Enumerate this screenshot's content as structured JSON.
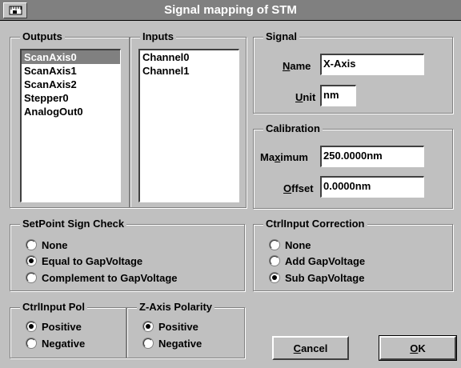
{
  "window": {
    "title": "Signal mapping of STM",
    "system_menu_icon": "ruler-icon"
  },
  "outputs": {
    "legend": "Outputs",
    "items": [
      "ScanAxis0",
      "ScanAxis1",
      "ScanAxis2",
      "Stepper0",
      "AnalogOut0"
    ],
    "selected": "ScanAxis0"
  },
  "inputs": {
    "legend": "Inputs",
    "items": [
      "Channel0",
      "Channel1"
    ]
  },
  "signal": {
    "legend": "Signal",
    "name_label_u": "N",
    "name_label_rest": "ame",
    "name_value": "X-Axis",
    "unit_label_u": "U",
    "unit_label_rest": "nit",
    "unit_value": "nm"
  },
  "calibration": {
    "legend": "Calibration",
    "max_label_pre": "Ma",
    "max_label_u": "x",
    "max_label_rest": "imum",
    "max_value": "250.0000nm",
    "offset_label_u": "O",
    "offset_label_rest": "ffset",
    "offset_value": "0.0000nm"
  },
  "setpoint": {
    "legend": "SetPoint Sign Check",
    "options": [
      "None",
      "Equal to GapVoltage",
      "Complement to GapVoltage"
    ],
    "selected_index": 1
  },
  "ctrlinput_correction": {
    "legend": "CtrlInput Correction",
    "options": [
      "None",
      "Add GapVoltage",
      "Sub GapVoltage"
    ],
    "selected_index": 2
  },
  "ctrlinput_pol": {
    "legend": "CtrlInput Pol",
    "options": [
      "Positive",
      "Negative"
    ],
    "selected_index": 0
  },
  "zaxis_polarity": {
    "legend": "Z-Axis Polarity",
    "options": [
      "Positive",
      "Negative"
    ],
    "selected_index": 0
  },
  "buttons": {
    "cancel_u": "C",
    "cancel_rest": "ancel",
    "ok_u": "O",
    "ok_rest": "K"
  }
}
